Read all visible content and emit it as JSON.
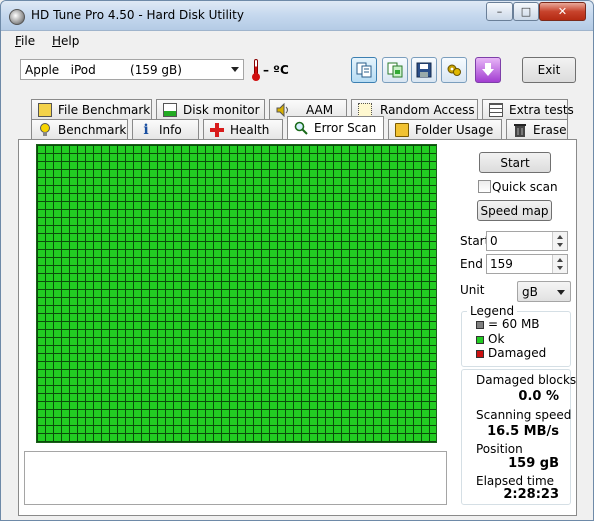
{
  "window": {
    "title": "HD Tune Pro 4.50 - Hard Disk Utility",
    "minimize_glyph": "–",
    "maximize_glyph": "□",
    "close_glyph": "✕"
  },
  "menu": {
    "file": "File",
    "help": "Help"
  },
  "toolbar": {
    "drive": "Apple   iPod         (159 gB)",
    "temperature": "– ºC",
    "exit_label": "Exit",
    "icons": [
      "copy-text-icon",
      "copy-screenshot-icon",
      "save-icon",
      "options-icon",
      "download-icon"
    ]
  },
  "tabs": {
    "top": [
      "File Benchmark",
      "Disk monitor",
      "AAM",
      "Random Access",
      "Extra tests"
    ],
    "bottom": [
      "Benchmark",
      "Info",
      "Health",
      "Error Scan",
      "Folder Usage",
      "Erase"
    ],
    "active": "Error Scan"
  },
  "scan": {
    "start_label": "Start",
    "quick_scan_label": "Quick scan",
    "quick_scan_checked": false,
    "speed_map_label": "Speed map",
    "range_start_label": "Start",
    "range_start_value": "0",
    "range_end_label": "End",
    "range_end_value": "159",
    "unit_label": "Unit",
    "unit_value": "gB",
    "block_status": "ok"
  },
  "legend": {
    "title": "Legend",
    "items": [
      {
        "label": "= 60 MB",
        "color": "#808080"
      },
      {
        "label": "Ok",
        "color": "#22cc22"
      },
      {
        "label": "Damaged",
        "color": "#cc1111"
      }
    ]
  },
  "stats": {
    "damaged_label": "Damaged blocks",
    "damaged_value": "0.0 %",
    "speed_label": "Scanning speed",
    "speed_value": "16.5 MB/s",
    "position_label": "Position",
    "position_value": "159 gB",
    "elapsed_label": "Elapsed time",
    "elapsed_value": "2:28:23"
  }
}
